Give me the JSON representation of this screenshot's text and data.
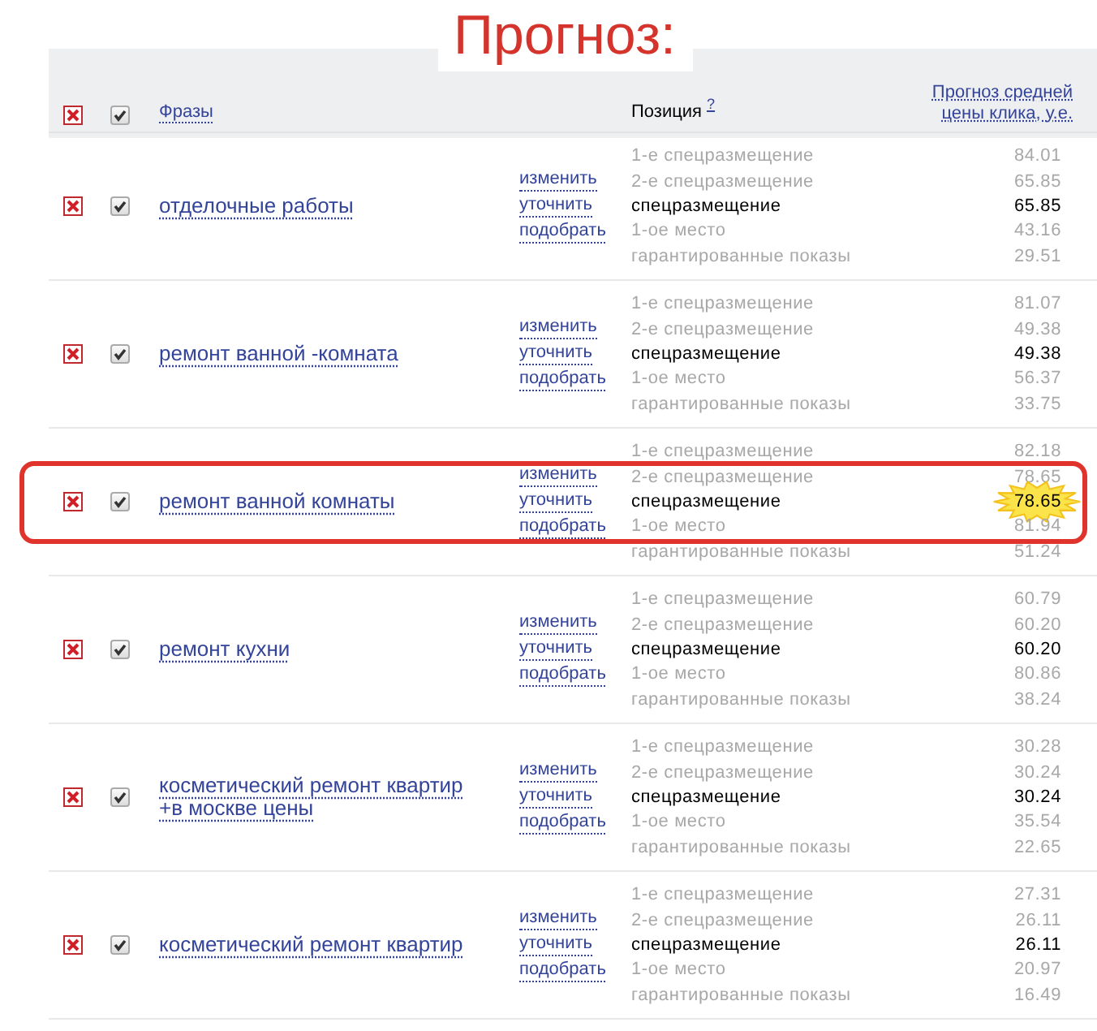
{
  "title": "Прогноз:",
  "header": {
    "delete_all": true,
    "all_checked": true,
    "phrases": "Фразы",
    "position": "Позиция",
    "position_help": "?",
    "price": "Прогноз средней цены клика, у.е."
  },
  "rows": [
    {
      "phrase": "отделочные работы",
      "checked": true,
      "highlighted": false,
      "actions": [
        "изменить",
        "уточнить",
        "подобрать"
      ],
      "positions": [
        {
          "label": "1-е спецразмещение",
          "value": "84.01",
          "selected": false,
          "starred": false
        },
        {
          "label": "2-е спецразмещение",
          "value": "65.85",
          "selected": false,
          "starred": false
        },
        {
          "label": "спецразмещение",
          "value": "65.85",
          "selected": true,
          "starred": false
        },
        {
          "label": "1-ое место",
          "value": "43.16",
          "selected": false,
          "starred": false
        },
        {
          "label": "гарантированные показы",
          "value": "29.51",
          "selected": false,
          "starred": false
        }
      ]
    },
    {
      "phrase": "ремонт ванной -комната",
      "checked": true,
      "highlighted": false,
      "actions": [
        "изменить",
        "уточнить",
        "подобрать"
      ],
      "positions": [
        {
          "label": "1-е спецразмещение",
          "value": "81.07",
          "selected": false,
          "starred": false
        },
        {
          "label": "2-е спецразмещение",
          "value": "49.38",
          "selected": false,
          "starred": false
        },
        {
          "label": "спецразмещение",
          "value": "49.38",
          "selected": true,
          "starred": false
        },
        {
          "label": "1-ое место",
          "value": "56.37",
          "selected": false,
          "starred": false
        },
        {
          "label": "гарантированные показы",
          "value": "33.75",
          "selected": false,
          "starred": false
        }
      ]
    },
    {
      "phrase": "ремонт ванной комнаты",
      "checked": true,
      "highlighted": true,
      "actions": [
        "изменить",
        "уточнить",
        "подобрать"
      ],
      "positions": [
        {
          "label": "1-е спецразмещение",
          "value": "82.18",
          "selected": false,
          "starred": false
        },
        {
          "label": "2-е спецразмещение",
          "value": "78.65",
          "selected": false,
          "starred": false
        },
        {
          "label": "спецразмещение",
          "value": "78.65",
          "selected": true,
          "starred": true
        },
        {
          "label": "1-ое место",
          "value": "81.94",
          "selected": false,
          "starred": false
        },
        {
          "label": "гарантированные показы",
          "value": "51.24",
          "selected": false,
          "starred": false
        }
      ]
    },
    {
      "phrase": "ремонт кухни",
      "checked": true,
      "highlighted": false,
      "actions": [
        "изменить",
        "уточнить",
        "подобрать"
      ],
      "positions": [
        {
          "label": "1-е спецразмещение",
          "value": "60.79",
          "selected": false,
          "starred": false
        },
        {
          "label": "2-е спецразмещение",
          "value": "60.20",
          "selected": false,
          "starred": false
        },
        {
          "label": "спецразмещение",
          "value": "60.20",
          "selected": true,
          "starred": false
        },
        {
          "label": "1-ое место",
          "value": "80.86",
          "selected": false,
          "starred": false
        },
        {
          "label": "гарантированные показы",
          "value": "38.24",
          "selected": false,
          "starred": false
        }
      ]
    },
    {
      "phrase": "косметический ремонт квартир +в москве цены",
      "checked": true,
      "highlighted": false,
      "actions": [
        "изменить",
        "уточнить",
        "подобрать"
      ],
      "positions": [
        {
          "label": "1-е спецразмещение",
          "value": "30.28",
          "selected": false,
          "starred": false
        },
        {
          "label": "2-е спецразмещение",
          "value": "30.24",
          "selected": false,
          "starred": false
        },
        {
          "label": "спецразмещение",
          "value": "30.24",
          "selected": true,
          "starred": false
        },
        {
          "label": "1-ое место",
          "value": "35.54",
          "selected": false,
          "starred": false
        },
        {
          "label": "гарантированные показы",
          "value": "22.65",
          "selected": false,
          "starred": false
        }
      ]
    },
    {
      "phrase": "косметический ремонт квартир",
      "checked": true,
      "highlighted": false,
      "actions": [
        "изменить",
        "уточнить",
        "подобрать"
      ],
      "positions": [
        {
          "label": "1-е спецразмещение",
          "value": "27.31",
          "selected": false,
          "starred": false
        },
        {
          "label": "2-е спецразмещение",
          "value": "26.11",
          "selected": false,
          "starred": false
        },
        {
          "label": "спецразмещение",
          "value": "26.11",
          "selected": true,
          "starred": false
        },
        {
          "label": "1-ое место",
          "value": "20.97",
          "selected": false,
          "starred": false
        },
        {
          "label": "гарантированные показы",
          "value": "16.49",
          "selected": false,
          "starred": false
        }
      ]
    }
  ]
}
